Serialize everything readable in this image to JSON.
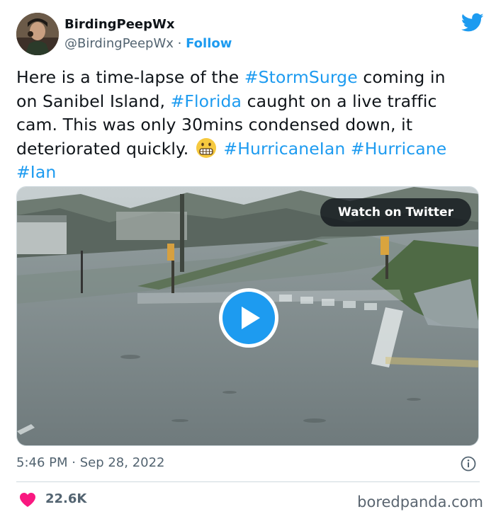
{
  "author": {
    "name": "BirdingPeepWx",
    "handle": "@BirdingPeepWx",
    "separator": " · ",
    "follow_label": "Follow"
  },
  "tweet": {
    "lines": [
      [
        {
          "t": "Here is a time-lapse of the "
        },
        {
          "t": "#StormSurge",
          "tag": true
        },
        {
          "t": " coming in"
        }
      ],
      [
        {
          "t": "on Sanibel Island, "
        },
        {
          "t": "#Florida",
          "tag": true
        },
        {
          "t": " caught on a live traffic"
        }
      ],
      [
        {
          "t": "cam. This was only 30mins condensed down, it"
        }
      ],
      [
        {
          "t": "deteriorated quickly. "
        },
        {
          "emoji": "grimacing-face-emoji"
        },
        {
          "t": " "
        },
        {
          "t": "#HurricaneIan",
          "tag": true
        },
        {
          "t": " "
        },
        {
          "t": "#Hurricane",
          "tag": true
        }
      ],
      [
        {
          "t": "#Ian",
          "tag": true
        }
      ]
    ]
  },
  "media": {
    "watch_label": "Watch on Twitter",
    "play_icon": "play-icon"
  },
  "meta": {
    "time": "5:46 PM",
    "separator": " · ",
    "date": "Sep 28, 2022"
  },
  "engagement": {
    "likes": "22.6K"
  },
  "watermark": "boredpanda.com",
  "colors": {
    "accent": "#1d9bf0",
    "text": "#0f1419",
    "secondary": "#536471",
    "like": "#f91880"
  }
}
